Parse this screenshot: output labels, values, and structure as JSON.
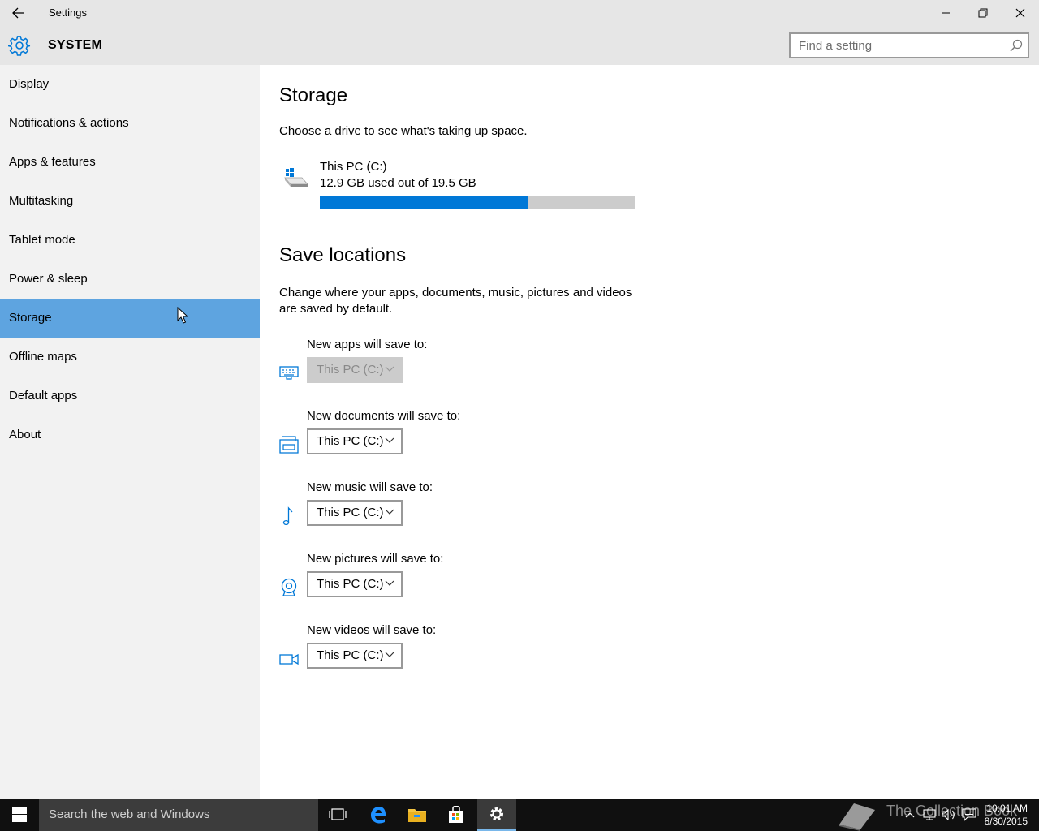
{
  "window": {
    "title": "Settings",
    "back_icon": "back-arrow-icon",
    "controls": [
      "minimize-icon",
      "restore-icon",
      "close-icon"
    ]
  },
  "header": {
    "section_title": "SYSTEM",
    "icon": "gear-icon",
    "search_placeholder": "Find a setting"
  },
  "sidebar": {
    "items": [
      {
        "label": "Display"
      },
      {
        "label": "Notifications & actions"
      },
      {
        "label": "Apps & features"
      },
      {
        "label": "Multitasking"
      },
      {
        "label": "Tablet mode"
      },
      {
        "label": "Power & sleep"
      },
      {
        "label": "Storage",
        "selected": true
      },
      {
        "label": "Offline maps"
      },
      {
        "label": "Default apps"
      },
      {
        "label": "About"
      }
    ]
  },
  "main": {
    "title": "Storage",
    "subtitle": "Choose a drive to see what's taking up space.",
    "drive": {
      "name": "This PC (C:)",
      "usage": "12.9 GB used out of 19.5 GB",
      "used_fraction": 0.66
    },
    "save_title": "Save locations",
    "save_desc": "Change where your apps, documents, music, pictures and videos are saved by default.",
    "locations": [
      {
        "label": "New apps will save to:",
        "value": "This PC (C:)",
        "icon": "monitor-keyboard-icon",
        "disabled": true
      },
      {
        "label": "New documents will save to:",
        "value": "This PC (C:)",
        "icon": "document-tray-icon",
        "disabled": false
      },
      {
        "label": "New music will save to:",
        "value": "This PC (C:)",
        "icon": "music-note-icon",
        "disabled": false
      },
      {
        "label": "New pictures will save to:",
        "value": "This PC (C:)",
        "icon": "webcam-icon",
        "disabled": false
      },
      {
        "label": "New videos will save to:",
        "value": "This PC (C:)",
        "icon": "video-camera-icon",
        "disabled": false
      }
    ]
  },
  "taskbar": {
    "search_text": "Search the web and Windows",
    "time": "10:01 AM",
    "date": "8/30/2015",
    "watermark": "The Collection Book"
  },
  "colors": {
    "accent": "#0078d7",
    "selected_nav": "#5ea4e0",
    "chrome": "#e6e6e6",
    "sidebar": "#f2f2f2"
  }
}
